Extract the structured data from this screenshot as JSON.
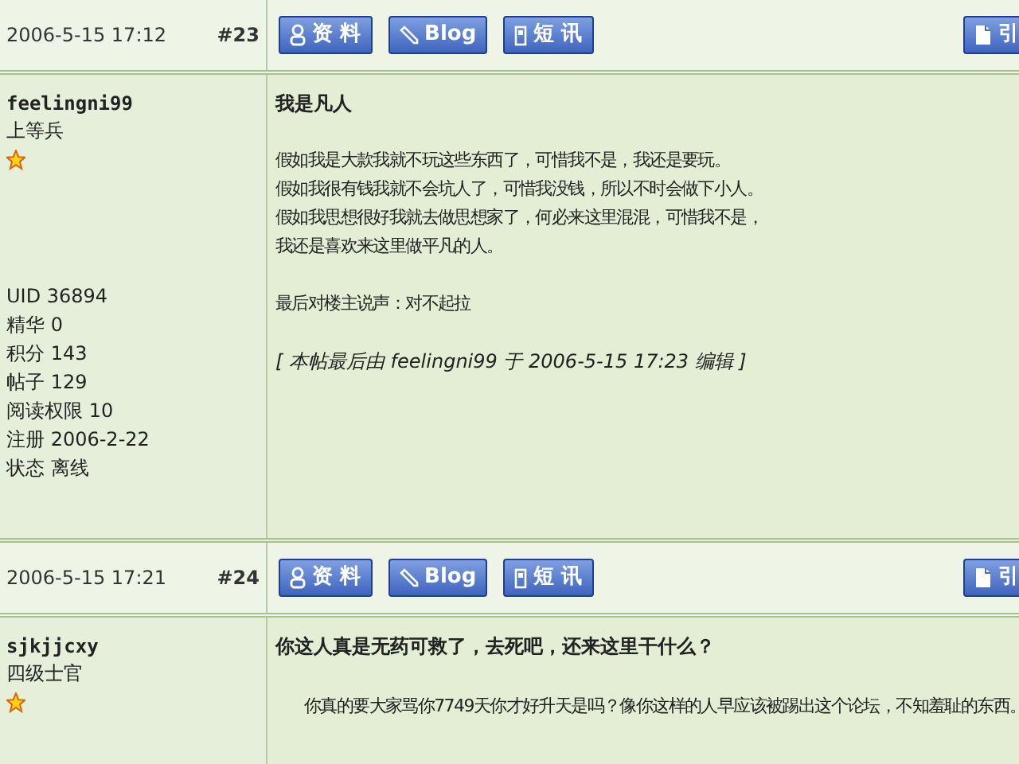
{
  "posts": [
    {
      "time": "2006-5-15 17:12",
      "floor": "#23",
      "buttons": [
        {
          "kind": "profile",
          "label": "资 料"
        },
        {
          "kind": "blog",
          "label": "Blog"
        },
        {
          "kind": "message",
          "label": "短 讯"
        }
      ],
      "quote_button": {
        "label": "引"
      },
      "author": "feelingni99",
      "rank": "上等兵",
      "stats": [
        "UID 36894",
        "精华 0",
        "积分 143",
        "帖子 129",
        "阅读权限 10",
        "注册 2006-2-22",
        "状态 离线"
      ],
      "title": "我是凡人",
      "indent": false,
      "paragraphs": [
        [
          "假如我是大款我就不玩这些东西了，可惜我不是，我还是要玩。",
          "假如我很有钱我就不会坑人了，可惜我没钱，所以不时会做下小人。",
          "假如我思想很好我就去做思想家了，何必来这里混混，可惜我不是，",
          "我还是喜欢来这里做平凡的人。"
        ],
        [
          "最后对楼主说声：对不起拉"
        ]
      ],
      "edit_note": "[ 本帖最后由 feelingni99 于 2006-5-15 17:23 编辑 ]"
    },
    {
      "time": "2006-5-15 17:21",
      "floor": "#24",
      "buttons": [
        {
          "kind": "profile",
          "label": "资 料"
        },
        {
          "kind": "blog",
          "label": "Blog"
        },
        {
          "kind": "message",
          "label": "短 讯"
        }
      ],
      "quote_button": {
        "label": "引"
      },
      "author": "sjkjjcxy",
      "rank": "四级士官",
      "title": "你这人真是无药可救了，去死吧，还来这里干什么？",
      "indent": true,
      "paragraphs": [
        [
          "你真的要大家骂你7749天你才好升天是吗？像你这样的人早应该被踢出这个论坛，不知羞耻的东西。"
        ]
      ]
    }
  ]
}
